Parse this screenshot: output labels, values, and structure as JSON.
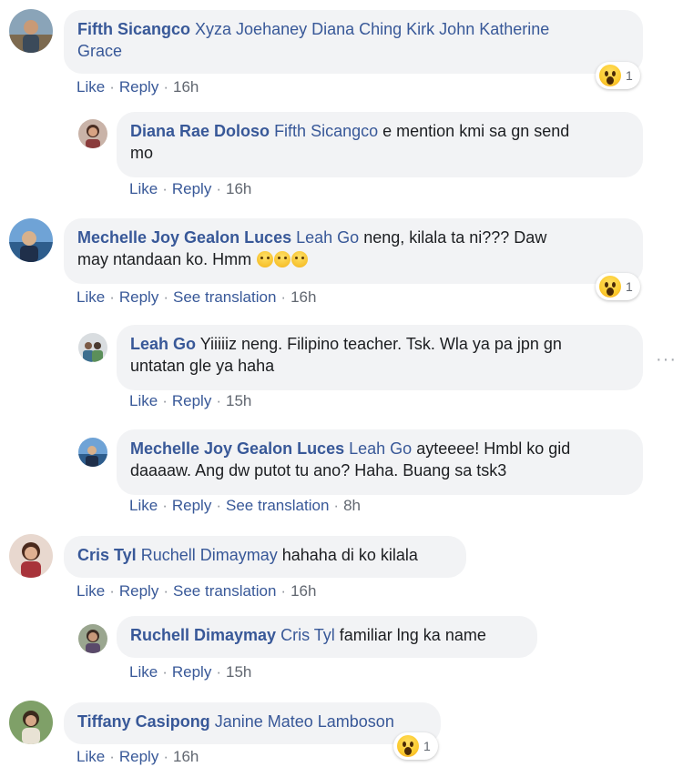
{
  "comments": [
    {
      "author": "Fifth Sicangco",
      "mention": "Xyza Joehaney Diana Ching Kirk John Katherine",
      "mention2": "Grace",
      "text": "",
      "like": "Like",
      "reply": "Reply",
      "time": "16h",
      "reaction_count": "1"
    },
    {
      "author": "Diana Rae Doloso",
      "mention": "Fifth Sicangco",
      "text": "e mention kmi sa gn send",
      "text2": "mo",
      "like": "Like",
      "reply": "Reply",
      "time": "16h"
    },
    {
      "author": "Mechelle Joy Gealon Luces",
      "mention": "Leah Go",
      "text": "neng, kilala ta ni??? Daw",
      "text2": "may ntandaan ko. Hmm",
      "like": "Like",
      "reply": "Reply",
      "translate": "See translation",
      "time": "16h",
      "reaction_count": "1"
    },
    {
      "author": "Leah Go",
      "text": "Yiiiiiz neng. Filipino teacher. Tsk. Wla ya pa jpn gn",
      "text2": "untatan gle ya haha",
      "like": "Like",
      "reply": "Reply",
      "time": "15h"
    },
    {
      "author": "Mechelle Joy Gealon Luces",
      "mention": "Leah Go",
      "text": "ayteeee! Hmbl ko gid",
      "text2": "daaaaw. Ang dw putot tu ano? Haha. Buang sa tsk3",
      "like": "Like",
      "reply": "Reply",
      "translate": "See translation",
      "time": "8h"
    },
    {
      "author": "Cris Tyl",
      "mention": "Ruchell Dimaymay",
      "text": "hahaha di ko kilala",
      "like": "Like",
      "reply": "Reply",
      "translate": "See translation",
      "time": "16h"
    },
    {
      "author": "Ruchell Dimaymay",
      "mention": "Cris Tyl",
      "text": "familiar lng ka name",
      "like": "Like",
      "reply": "Reply",
      "time": "15h"
    },
    {
      "author": "Tiffany Casipong",
      "mention": "Janine Mateo Lamboson",
      "text": "",
      "like": "Like",
      "reply": "Reply",
      "time": "16h",
      "reaction_count": "1"
    }
  ],
  "icons": {
    "reaction": "wow-reaction-icon",
    "emoji": "disappointed-relieved-emoji",
    "more": "more-options-icon"
  },
  "colors": {
    "link": "#385898",
    "bubble": "#f2f3f5",
    "meta": "#616770"
  },
  "more_options": "···"
}
